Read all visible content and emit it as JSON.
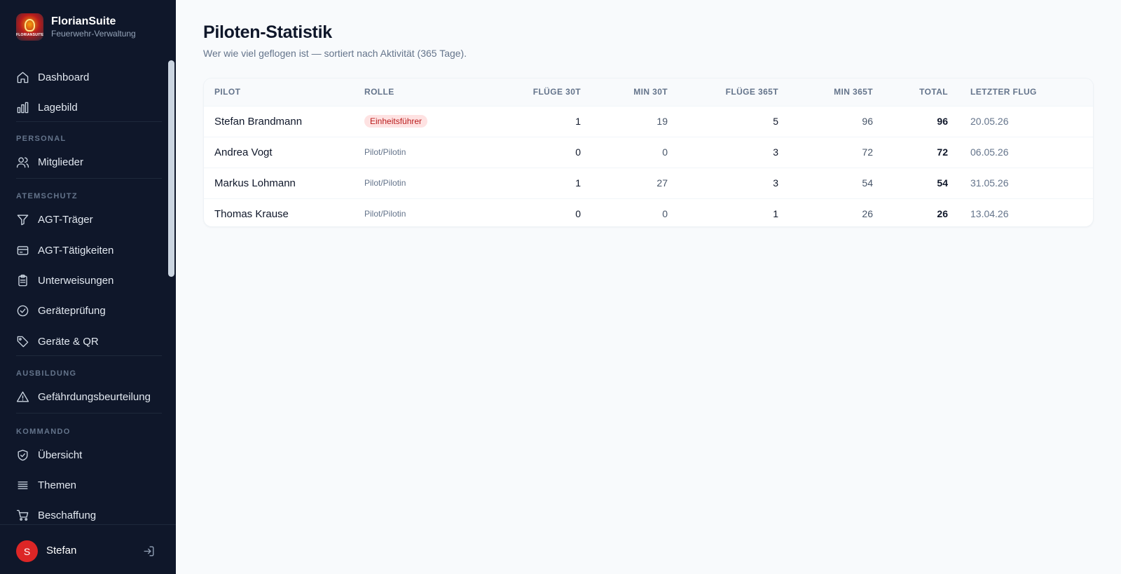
{
  "brand": {
    "name": "FlorianSuite",
    "subtitle": "Feuerwehr-Verwaltung",
    "logo_text": "FLORIANSUITE"
  },
  "sidebar": {
    "items_top": [
      {
        "label": "Dashboard",
        "icon": "home-icon"
      },
      {
        "label": "Lagebild",
        "icon": "bar-chart-icon"
      }
    ],
    "sections": [
      {
        "title": "PERSONAL",
        "items": [
          {
            "label": "Mitglieder",
            "icon": "users-icon"
          }
        ]
      },
      {
        "title": "ATEMSCHUTZ",
        "items": [
          {
            "label": "AGT-Träger",
            "icon": "filter-icon"
          },
          {
            "label": "AGT-Tätigkeiten",
            "icon": "card-icon"
          },
          {
            "label": "Unterweisungen",
            "icon": "clipboard-icon"
          },
          {
            "label": "Geräteprüfung",
            "icon": "check-circle-icon"
          },
          {
            "label": "Geräte & QR",
            "icon": "tag-icon"
          }
        ]
      },
      {
        "title": "AUSBILDUNG",
        "items": [
          {
            "label": "Gefährdungsbeurteilung",
            "icon": "warning-icon"
          }
        ]
      },
      {
        "title": "KOMMANDO",
        "items": [
          {
            "label": "Übersicht",
            "icon": "shield-check-icon"
          },
          {
            "label": "Themen",
            "icon": "list-icon"
          },
          {
            "label": "Beschaffung",
            "icon": "cart-icon"
          }
        ]
      }
    ]
  },
  "user": {
    "initial": "S",
    "name": "Stefan"
  },
  "page": {
    "title": "Piloten-Statistik",
    "subtitle": "Wer wie viel geflogen ist — sortiert nach Aktivität (365 Tage)."
  },
  "table": {
    "headers": [
      "PILOT",
      "ROLLE",
      "FLÜGE 30T",
      "MIN 30T",
      "FLÜGE 365T",
      "MIN 365T",
      "TOTAL",
      "LETZTER FLUG"
    ],
    "rows": [
      {
        "pilot": "Stefan Brandmann",
        "role": "Einheitsführer",
        "role_style": "red",
        "f30": "1",
        "m30": "19",
        "f365": "5",
        "m365": "96",
        "total": "96",
        "last": "20.05.26"
      },
      {
        "pilot": "Andrea Vogt",
        "role": "Pilot/Pilotin",
        "role_style": "plain",
        "f30": "0",
        "m30": "0",
        "f365": "3",
        "m365": "72",
        "total": "72",
        "last": "06.05.26"
      },
      {
        "pilot": "Markus Lohmann",
        "role": "Pilot/Pilotin",
        "role_style": "plain",
        "f30": "1",
        "m30": "27",
        "f365": "3",
        "m365": "54",
        "total": "54",
        "last": "31.05.26"
      },
      {
        "pilot": "Thomas Krause",
        "role": "Pilot/Pilotin",
        "role_style": "plain",
        "f30": "0",
        "m30": "0",
        "f365": "1",
        "m365": "26",
        "total": "26",
        "last": "13.04.26"
      }
    ]
  },
  "colors": {
    "sidebar_bg": "#0f172a",
    "accent_red": "#dc2626",
    "badge_red_bg": "#fee2e2",
    "badge_red_text": "#b91c1c"
  }
}
